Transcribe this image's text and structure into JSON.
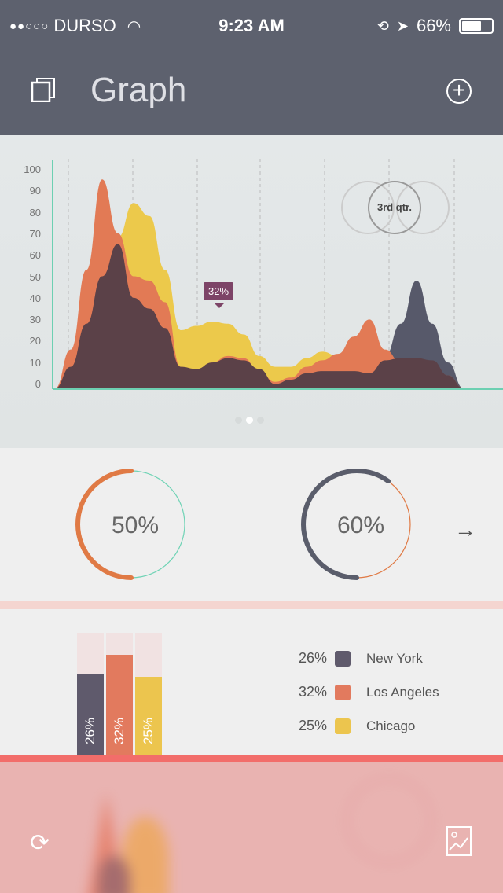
{
  "status_bar": {
    "signal": "●●○○○",
    "carrier": "DURSO",
    "time": "9:23 AM",
    "battery": "66%",
    "battery_level": 0.66
  },
  "header": {
    "title": "Graph"
  },
  "chart_data": {
    "type": "area",
    "title": "",
    "xlabel": "",
    "ylabel": "",
    "ylim": [
      0,
      100
    ],
    "y_ticks": [
      "100",
      "90",
      "80",
      "70",
      "60",
      "50",
      "40",
      "30",
      "20",
      "10",
      "0"
    ],
    "grid": "vertical dashed",
    "series": [
      {
        "color": "#57596a",
        "values": [
          0,
          0,
          0,
          0,
          0,
          0,
          0,
          0,
          0,
          0,
          0,
          0,
          0,
          0,
          0,
          0,
          0,
          0,
          0,
          0,
          5,
          15,
          30,
          50,
          30,
          12,
          0
        ]
      },
      {
        "color": "#ecc94b",
        "values": [
          0,
          5,
          15,
          40,
          70,
          86,
          80,
          55,
          27,
          29,
          31,
          30,
          25,
          15,
          10,
          10,
          14,
          17,
          15,
          10,
          5,
          0,
          0,
          0,
          0,
          0,
          0
        ]
      },
      {
        "color": "#e27a55",
        "values": [
          0,
          18,
          55,
          97,
          72,
          52,
          50,
          40,
          10,
          8,
          12,
          15,
          14,
          8,
          3,
          5,
          10,
          13,
          16,
          24,
          32,
          18,
          12,
          12,
          12,
          6,
          0
        ]
      },
      {
        "color": "#5b4148",
        "values": [
          0,
          10,
          30,
          52,
          67,
          42,
          37,
          28,
          10,
          9,
          12,
          14,
          13,
          9,
          2,
          4,
          7,
          8,
          8,
          8,
          7,
          13,
          14,
          14,
          13,
          6,
          0
        ]
      }
    ],
    "tooltip": "32%",
    "quarter_label": "3rd qtr."
  },
  "pager": {
    "count": 3,
    "active": 1
  },
  "donuts": [
    {
      "label": "50%",
      "value": 0.5,
      "color": "#e07a45",
      "rest": "#6fd3b5"
    },
    {
      "label": "60%",
      "value": 0.6,
      "color": "#5a5d6b",
      "rest": "#e07a45"
    }
  ],
  "bars": [
    {
      "label": "26%",
      "value": 26,
      "city": "New York",
      "color": "#5f5a6c"
    },
    {
      "label": "32%",
      "value": 32,
      "city": "Los Angeles",
      "color": "#e27a5e"
    },
    {
      "label": "25%",
      "value": 25,
      "city": "Chicago",
      "color": "#ecc54e"
    }
  ]
}
